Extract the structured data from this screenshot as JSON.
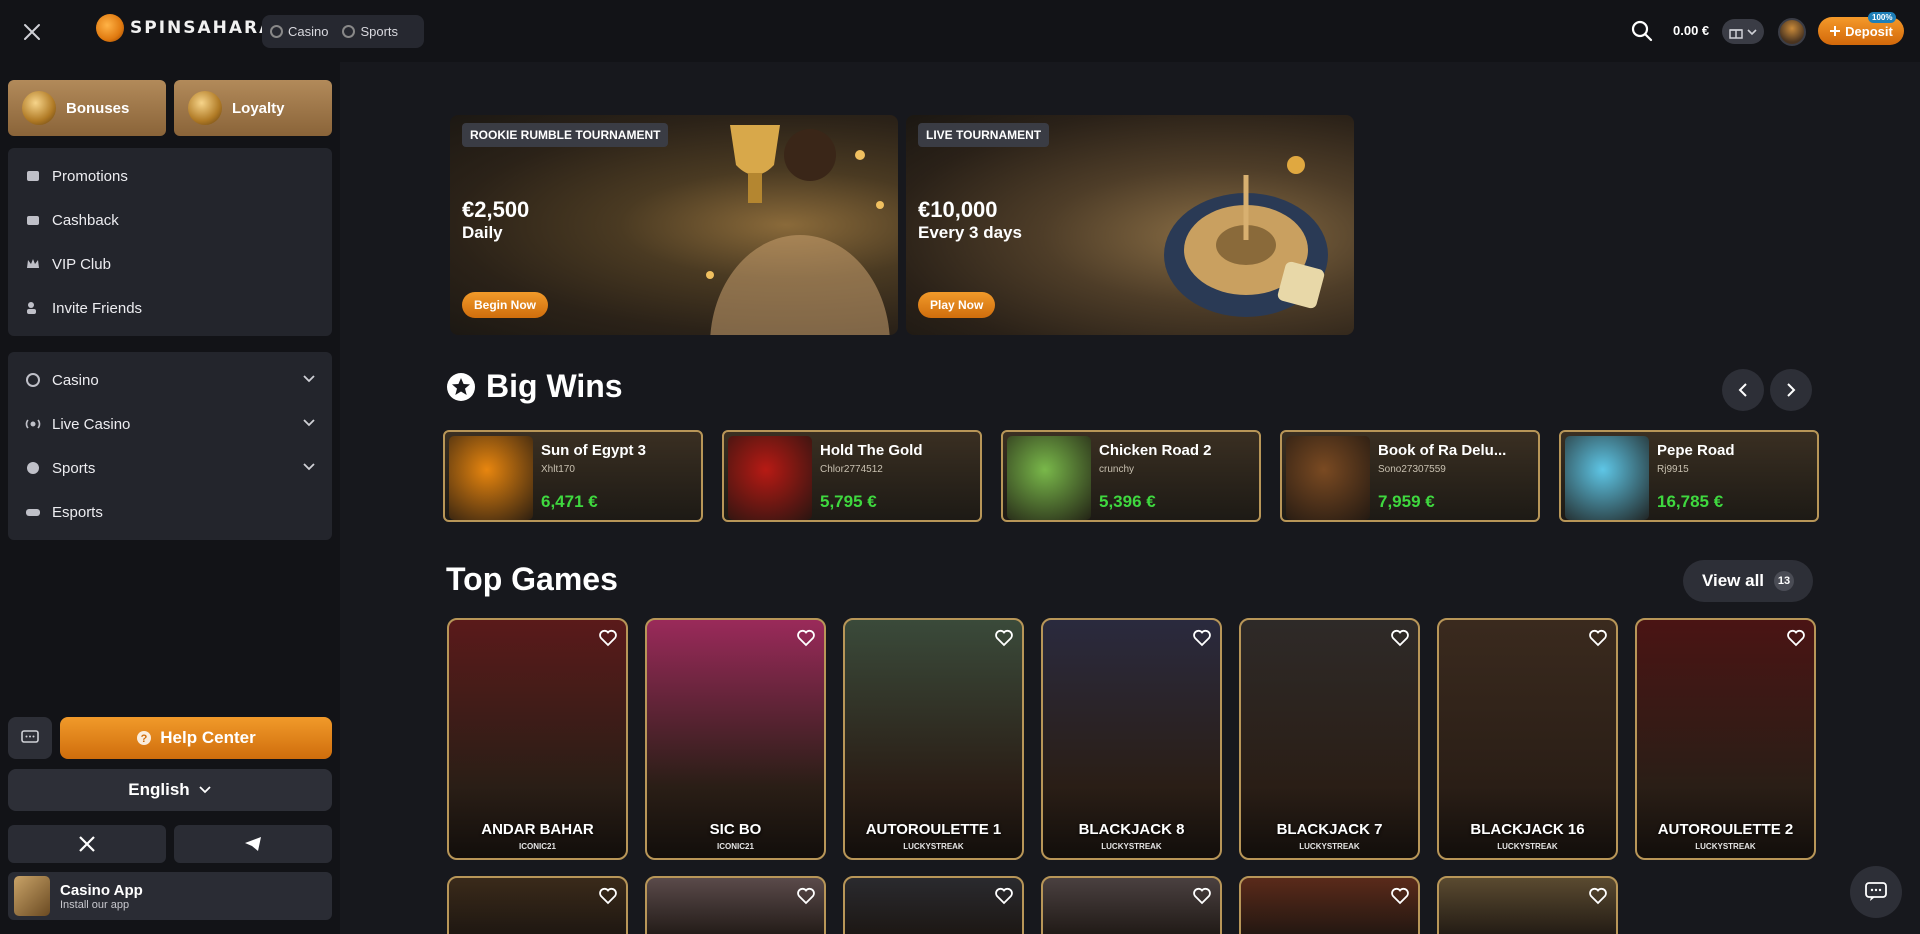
{
  "header": {
    "logo_text": "SPINSAHARA",
    "nav": [
      {
        "label": "Casino"
      },
      {
        "label": "Sports"
      }
    ],
    "balance": "0.00 €",
    "deposit_label": "Deposit",
    "bonus_badge": "100%"
  },
  "sidebar": {
    "top_cards": [
      {
        "label": "Bonuses"
      },
      {
        "label": "Loyalty"
      }
    ],
    "promo_items": [
      {
        "label": "Promotions",
        "icon": "promotions-icon"
      },
      {
        "label": "Cashback",
        "icon": "cashback-icon"
      },
      {
        "label": "VIP Club",
        "icon": "crown-icon"
      },
      {
        "label": "Invite Friends",
        "icon": "invite-icon"
      }
    ],
    "nav_items": [
      {
        "label": "Casino",
        "icon": "casino-icon",
        "expandable": true
      },
      {
        "label": "Live Casino",
        "icon": "live-icon",
        "expandable": true
      },
      {
        "label": "Sports",
        "icon": "sports-icon",
        "expandable": true
      },
      {
        "label": "Esports",
        "icon": "gamepad-icon",
        "expandable": false
      }
    ],
    "help_label": "Help Center",
    "language": "English",
    "app_title": "Casino App",
    "app_subtitle": "Install our app"
  },
  "banners": [
    {
      "tag": "ROOKIE RUMBLE TOURNAMENT",
      "amount": "€2,500",
      "period": "Daily",
      "cta": "Begin Now"
    },
    {
      "tag": "LIVE TOURNAMENT",
      "amount": "€10,000",
      "period": "Every 3 days",
      "cta": "Play Now"
    }
  ],
  "big_wins": {
    "title": "Big Wins",
    "items": [
      {
        "game": "Sun of Egypt 3",
        "user": "Xhlt170",
        "amount": "6,471 €",
        "thumb": "#e8860f"
      },
      {
        "game": "Hold The Gold",
        "user": "Chlor2774512",
        "amount": "5,795 €",
        "thumb": "#b71a14"
      },
      {
        "game": "Chicken Road 2",
        "user": "crunchy",
        "amount": "5,396 €",
        "thumb": "#79b84a"
      },
      {
        "game": "Book of Ra Delu...",
        "user": "Sono27307559",
        "amount": "7,959 €",
        "thumb": "#7a4a22"
      },
      {
        "game": "Pepe Road",
        "user": "Rj9915",
        "amount": "16,785 €",
        "thumb": "#5ec6e6"
      }
    ]
  },
  "top_games": {
    "title": "Top Games",
    "view_all": "View all",
    "count": "13",
    "items": [
      {
        "title": "ANDAR BAHAR",
        "provider": "ICONIC21",
        "bg": "#5a1a1a"
      },
      {
        "title": "SIC BO",
        "provider": "ICONIC21",
        "bg": "#9a2a5a"
      },
      {
        "title": "AUTOROULETTE 1",
        "provider": "LUCKYSTREAK",
        "bg": "#3a4a3a"
      },
      {
        "title": "BLACKJACK 8",
        "provider": "LUCKYSTREAK",
        "bg": "#2a2a3e"
      },
      {
        "title": "BLACKJACK 7",
        "provider": "LUCKYSTREAK",
        "bg": "#2e2a28"
      },
      {
        "title": "BLACKJACK 16",
        "provider": "LUCKYSTREAK",
        "bg": "#3a2a1e"
      },
      {
        "title": "AUTOROULETTE 2",
        "provider": "LUCKYSTREAK",
        "bg": "#4a1414"
      }
    ],
    "row2_bgs": [
      "#3a2a1a",
      "#5a4a4a",
      "#2a2a2e",
      "#4a4040",
      "#5a2a1a",
      "#5a4a30"
    ]
  },
  "colors": {
    "accent": "#f0902a",
    "win_green": "#3fd83f",
    "gold_border": "#b89658"
  }
}
